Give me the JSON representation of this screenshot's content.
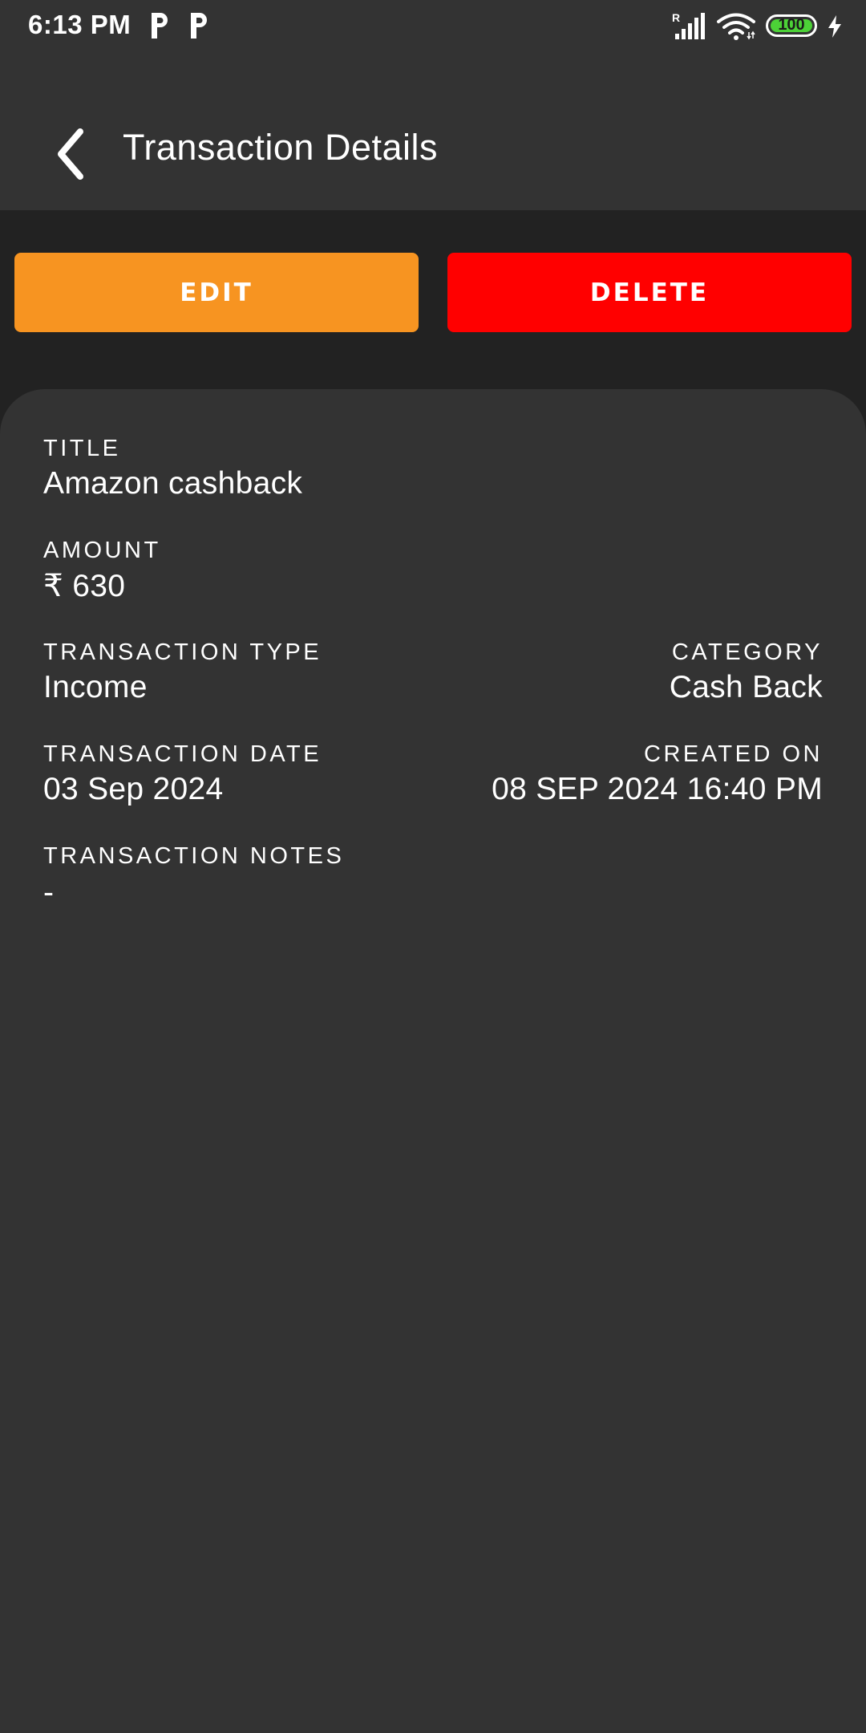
{
  "status_bar": {
    "time": "6:13 PM",
    "notification_icons": [
      "parking-p-icon",
      "parking-p-icon"
    ],
    "signal_icon": "signal-icon",
    "signal_badge": "R",
    "wifi_icon": "wifi-icon",
    "battery_level": "100",
    "battery_color": "#4cd137",
    "charging_icon": "charging-bolt-icon"
  },
  "app_bar": {
    "back_icon": "back-chevron-icon",
    "title": "Transaction Details"
  },
  "actions": {
    "edit_label": "EDIT",
    "edit_color": "#f79421",
    "delete_label": "DELETE",
    "delete_color": "#ff0000"
  },
  "details": {
    "title_label": "TITLE",
    "title_value": "Amazon cashback",
    "amount_label": "AMOUNT",
    "amount_value": "₹ 630",
    "type_label": "TRANSACTION TYPE",
    "type_value": "Income",
    "category_label": "CATEGORY",
    "category_value": "Cash Back",
    "date_label": "TRANSACTION DATE",
    "date_value": "03 Sep 2024",
    "created_label": "CREATED ON",
    "created_value": "08 SEP 2024 16:40 PM",
    "notes_label": "TRANSACTION NOTES",
    "notes_value": "-"
  }
}
